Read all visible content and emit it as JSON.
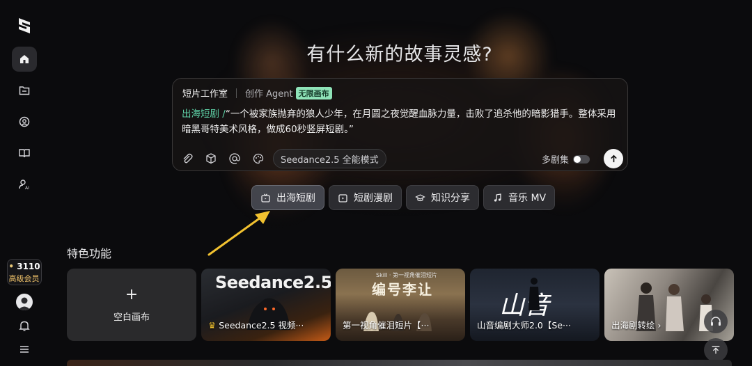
{
  "sidebar": {
    "items": [
      {
        "name": "home-icon"
      },
      {
        "name": "folder-icon"
      },
      {
        "name": "explore-icon"
      },
      {
        "name": "book-icon"
      },
      {
        "name": "user-ai-icon"
      }
    ],
    "credits": {
      "count": "3110",
      "tier": "高级会员"
    }
  },
  "heading": "有什么新的故事灵感?",
  "composer": {
    "mode_active": "短片工作室",
    "mode_agent": "创作 Agent",
    "mode_badge": "无限画布",
    "prompt_tag": "出海短剧 /",
    "prompt_text": "“一个被家族抛弃的狼人少年，在月圆之夜觉醒血脉力量，击败了追杀他的暗影猎手。整体采用暗黑哥特美术风格，做成60秒竖屏短剧。”",
    "model": "Seedance2.5 全能模式",
    "multi_episode": "多剧集"
  },
  "chips": [
    {
      "label": "出海短剧",
      "icon": "tv-icon"
    },
    {
      "label": "短剧漫剧",
      "icon": "play-icon"
    },
    {
      "label": "知识分享",
      "icon": "graduation-icon"
    },
    {
      "label": "音乐 MV",
      "icon": "music-icon"
    }
  ],
  "features": {
    "title": "特色功能",
    "blank": "空白画布",
    "cards": [
      {
        "caption": "Seedance2.5 视频···",
        "overlay": "Seedance2.5"
      },
      {
        "caption": "第一视角催泪短片【···",
        "overlay": "编号李让",
        "sub": "Skill · 第一视角催泪短片"
      },
      {
        "caption": "山音编剧大师2.0【Se···",
        "overlay": "山音"
      },
      {
        "caption": "出海剧转绘"
      }
    ]
  },
  "colors": {
    "accent": "#5fd3a8",
    "badge": "#8fe3b8",
    "tier": "#f0c36a",
    "arrow": "#f2c230"
  }
}
